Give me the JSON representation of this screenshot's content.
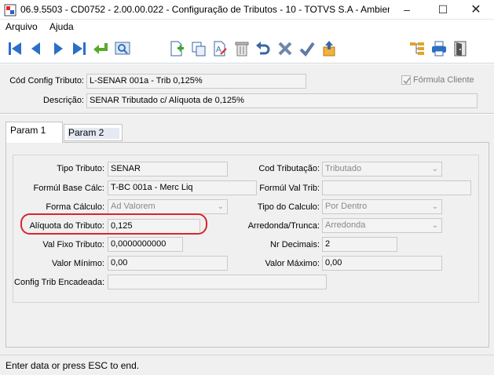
{
  "window": {
    "title": "06.9.5503 - CD0752 - 2.00.00.022 - Configuração de Tributos - 10 - TOTVS S.A - Ambient...",
    "minimize": "–",
    "maximize": "☐",
    "close": "✕"
  },
  "menu": {
    "items": [
      "Arquivo",
      "Ajuda"
    ]
  },
  "toolbar": {
    "icons": [
      "first-record-icon",
      "previous-record-icon",
      "next-record-icon",
      "last-record-icon",
      "return-icon",
      "search-icon",
      "new-record-icon",
      "copy-record-icon",
      "edit-record-icon",
      "delete-record-icon",
      "undo-icon",
      "cancel-icon",
      "confirm-icon",
      "export-icon",
      "tree-icon",
      "print-icon",
      "exit-icon"
    ]
  },
  "header": {
    "cod_label": "Cód Config Tributo:",
    "cod_value": "L-SENAR 001a - Trib 0,125%",
    "descricao_label": "Descrição:",
    "descricao_value": "SENAR Tributado c/ Alíquota de 0,125%",
    "formula_cliente_label": "Fórmula Cliente",
    "formula_cliente_checked": true
  },
  "tabs": {
    "param1": "Param 1",
    "param2": "Param 2"
  },
  "form": {
    "tipo_tributo_label": "Tipo Tributo:",
    "tipo_tributo_value": "SENAR",
    "cod_tributacao_label": "Cod Tributação:",
    "cod_tributacao_value": "Tributado",
    "formul_base_calc_label": "Formúl Base Cálc:",
    "formul_base_calc_value": "T-BC 001a - Merc Liq",
    "formul_val_trib_label": "Formúl Val Trib:",
    "formul_val_trib_value": "",
    "forma_calculo_label": "Forma Cálculo:",
    "forma_calculo_value": "Ad Valorem",
    "tipo_calculo_label": "Tipo do Calculo:",
    "tipo_calculo_value": "Por Dentro",
    "aliquota_label": "Alíquota do Tributo:",
    "aliquota_value": "0,125",
    "arredonda_label": "Arredonda/Trunca:",
    "arredonda_value": "Arredonda",
    "val_fixo_label": "Val Fixo Tributo:",
    "val_fixo_value": "0,0000000000",
    "nr_decimais_label": "Nr Decimais:",
    "nr_decimais_value": "2",
    "valor_minimo_label": "Valor Mínimo:",
    "valor_minimo_value": "0,00",
    "valor_maximo_label": "Valor Máximo:",
    "valor_maximo_value": "0,00",
    "config_trib_label": "Config Trib Encadeada:",
    "config_trib_value": ""
  },
  "status": {
    "text": "Enter data or press ESC to end."
  },
  "colors": {
    "toolbar_blue": "#2a6fc9",
    "highlight_red": "#d9262b",
    "panel_bg": "#f0f0f0"
  }
}
